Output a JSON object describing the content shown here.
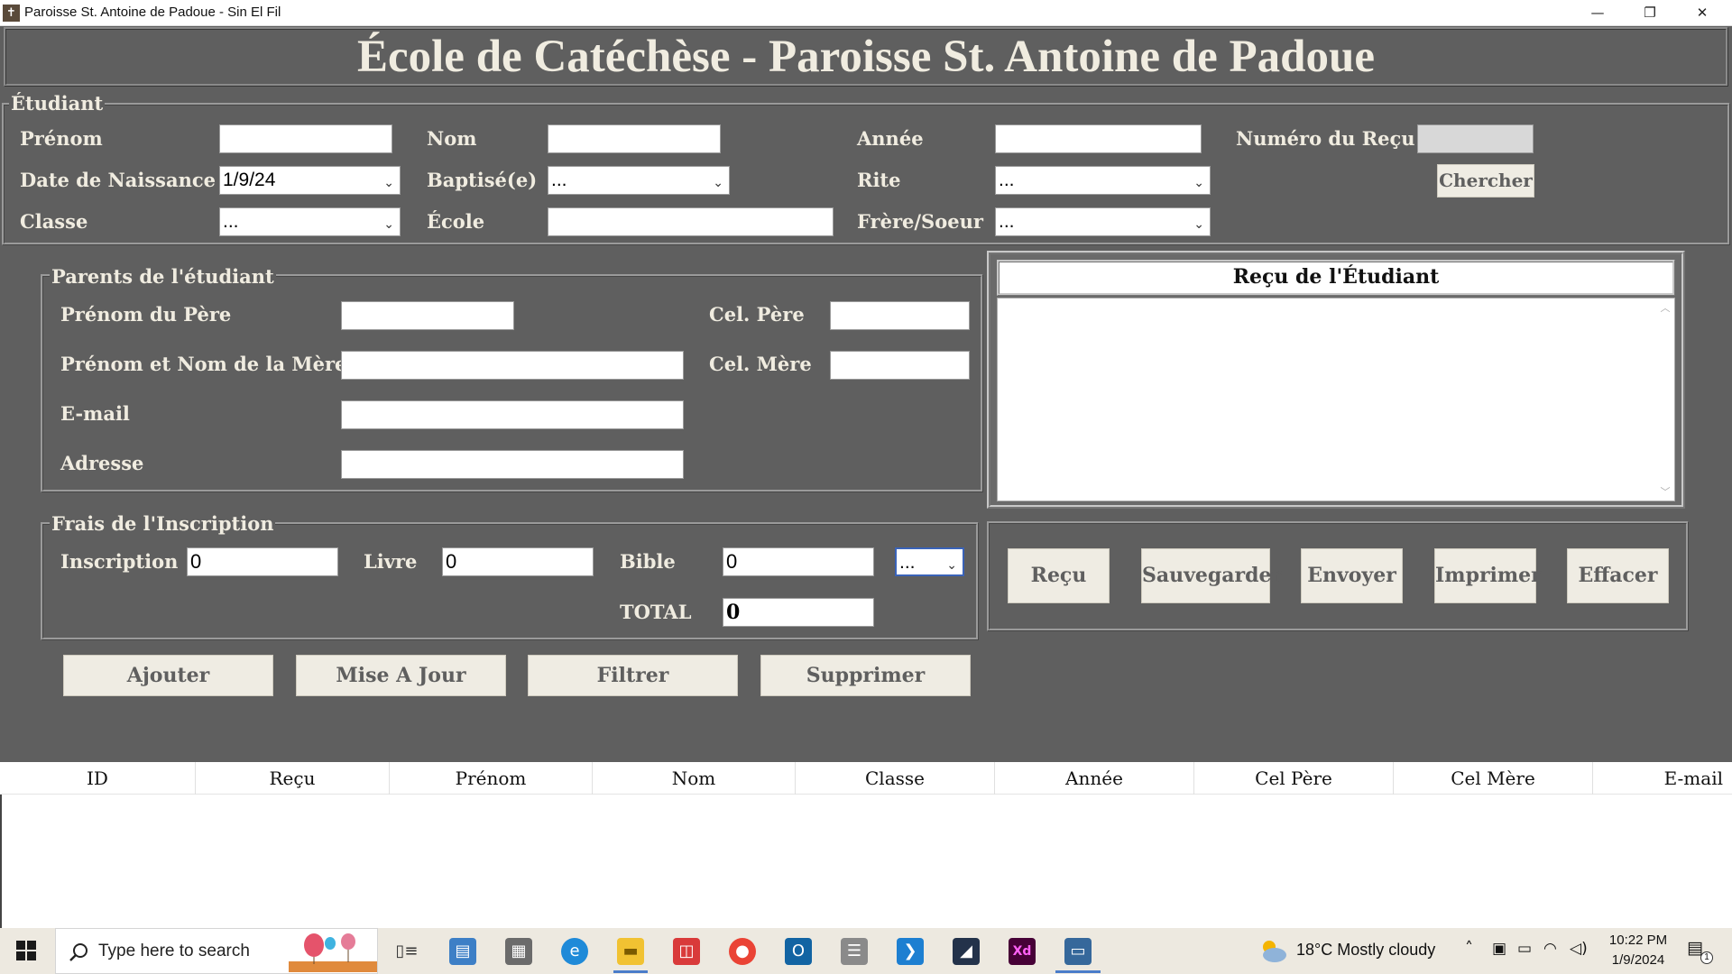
{
  "window": {
    "title": "Paroisse St. Antoine de Padoue - Sin El Fil",
    "app_icon": "✝",
    "minimize": "—",
    "restore": "❐",
    "close": "✕"
  },
  "banner": {
    "title": "École de Catéchèse - Paroisse St. Antoine de Padoue"
  },
  "student": {
    "legend": "Étudiant",
    "prenom_label": "Prénom",
    "prenom_value": "",
    "nom_label": "Nom",
    "nom_value": "",
    "annee_label": "Année",
    "annee_value": "",
    "numero_recu_label": "Numéro du Reçu",
    "numero_recu_value": "",
    "date_naissance_label": "Date de Naissance",
    "date_naissance_value": "1/9/24",
    "baptise_label": "Baptisé(e)",
    "baptise_value": "...",
    "rite_label": "Rite",
    "rite_value": "...",
    "chercher_button": "Chercher",
    "classe_label": "Classe",
    "classe_value": "...",
    "ecole_label": "École",
    "ecole_value": "",
    "frere_soeur_label": "Frère/Soeur",
    "frere_soeur_value": "..."
  },
  "parents": {
    "legend": "Parents de l'étudiant",
    "pere_label": "Prénom du Père",
    "pere_value": "",
    "cel_pere_label": "Cel. Père",
    "cel_pere_value": "",
    "mere_label": "Prénom et Nom de la Mère",
    "mere_value": "",
    "cel_mere_label": "Cel. Mère",
    "cel_mere_value": "",
    "email_label": "E-mail",
    "email_value": "",
    "adresse_label": "Adresse",
    "adresse_value": ""
  },
  "frais": {
    "legend": "Frais de l'Inscription",
    "inscription_label": "Inscription",
    "inscription_value": "0",
    "livre_label": "Livre",
    "livre_value": "0",
    "bible_label": "Bible",
    "bible_value": "0",
    "extra_select_value": "...",
    "total_label": "TOTAL",
    "total_value": "0"
  },
  "crud_buttons": {
    "ajouter": "Ajouter",
    "mise_a_jour": "Mise A Jour",
    "filtrer": "Filtrer",
    "supprimer": "Supprimer"
  },
  "receipt": {
    "header": "Reçu de l'Étudiant",
    "text": ""
  },
  "action_buttons": {
    "recu": "Reçu",
    "sauvegarder": "Sauvegarder",
    "envoyer": "Envoyer",
    "imprimer": "Imprimer",
    "effacer": "Effacer"
  },
  "table": {
    "columns": [
      "ID",
      "Reçu",
      "Prénom",
      "Nom",
      "Classe",
      "Année",
      "Cel Père",
      "Cel Mère",
      "E-mail"
    ]
  },
  "taskbar": {
    "search_placeholder": "Type here to search",
    "weather": "18°C  Mostly cloudy",
    "time": "10:22 PM",
    "date": "1/9/2024",
    "notifications": "1",
    "pinned": [
      "task-view-icon",
      "control-panel-icon",
      "calculator-icon",
      "edge-icon",
      "file-explorer-icon",
      "reader-icon",
      "chrome-icon",
      "outlook-icon",
      "database-icon",
      "vscode-icon",
      "dark-app-icon",
      "adobe-xd-icon",
      "python-app-icon"
    ]
  },
  "colors": {
    "panel_bg": "#5f5f5f",
    "label_text": "#f0ece0",
    "button_bg": "#efece3",
    "button_text": "#5f5f5f"
  }
}
